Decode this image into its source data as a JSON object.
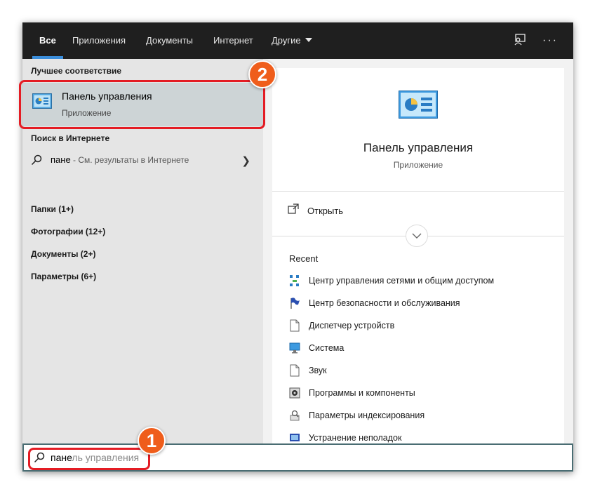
{
  "tabs": [
    {
      "label": "Все",
      "active": true
    },
    {
      "label": "Приложения"
    },
    {
      "label": "Документы"
    },
    {
      "label": "Интернет"
    },
    {
      "label": "Другие"
    }
  ],
  "topbar_icons": [
    "feedback-icon",
    "more-icon"
  ],
  "left": {
    "best_match_header": "Лучшее соответствие",
    "best_match": {
      "title": "Панель управления",
      "subtitle": "Приложение"
    },
    "web_header": "Поиск в Интернете",
    "web_query": "пане",
    "web_hint": " - См. результаты в Интернете",
    "categories": [
      "Папки (1+)",
      "Фотографии (12+)",
      "Документы (2+)",
      "Параметры (6+)"
    ]
  },
  "right": {
    "app_name": "Панель управления",
    "app_type": "Приложение",
    "open_label": "Открыть",
    "recent_header": "Recent",
    "recent_items": [
      {
        "label": "Центр управления сетями и общим доступом",
        "icon": "network-icon"
      },
      {
        "label": "Центр безопасности и обслуживания",
        "icon": "flag-icon"
      },
      {
        "label": "Диспетчер устройств",
        "icon": "document-icon"
      },
      {
        "label": "Система",
        "icon": "monitor-icon"
      },
      {
        "label": "Звук",
        "icon": "document-icon"
      },
      {
        "label": "Программы и компоненты",
        "icon": "programs-icon"
      },
      {
        "label": "Параметры индексирования",
        "icon": "indexing-icon"
      },
      {
        "label": "Устранение неполадок",
        "icon": "troubleshoot-icon"
      }
    ]
  },
  "search": {
    "typed": "пане",
    "autocomplete": "ль управления"
  },
  "annotations": {
    "badge1": "1",
    "badge2": "2"
  },
  "colors": {
    "accent": "#3b8edb",
    "highlight": "#e41c24",
    "badge": "#ef5d1b"
  }
}
